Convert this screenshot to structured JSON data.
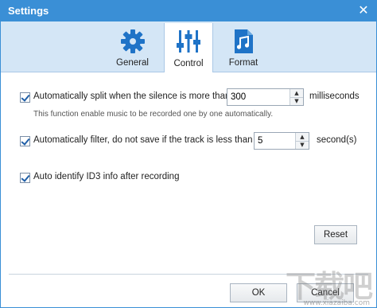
{
  "window": {
    "title": "Settings",
    "close_glyph": "✕"
  },
  "tabs": [
    {
      "label": "General",
      "icon": "gear-icon",
      "active": false
    },
    {
      "label": "Control",
      "icon": "sliders-icon",
      "active": true
    },
    {
      "label": "Format",
      "icon": "music-file-icon",
      "active": false
    }
  ],
  "options": {
    "split": {
      "checked": true,
      "label": "Automatically split when the silence is more than",
      "value": "300",
      "unit": "milliseconds",
      "hint": "This function enable music to be recorded one by one automatically."
    },
    "filter": {
      "checked": true,
      "label": "Automatically filter, do not save if the track is less than",
      "value": "5",
      "unit": "second(s)"
    },
    "id3": {
      "checked": true,
      "label": "Auto identify ID3 info after recording"
    }
  },
  "buttons": {
    "reset": "Reset",
    "ok": "OK",
    "cancel": "Cancel"
  },
  "watermark": {
    "text": "下载吧",
    "sub": "www.xiazaiba.com"
  },
  "colors": {
    "accent": "#3a8fd6",
    "tabbar": "#d4e6f6"
  }
}
